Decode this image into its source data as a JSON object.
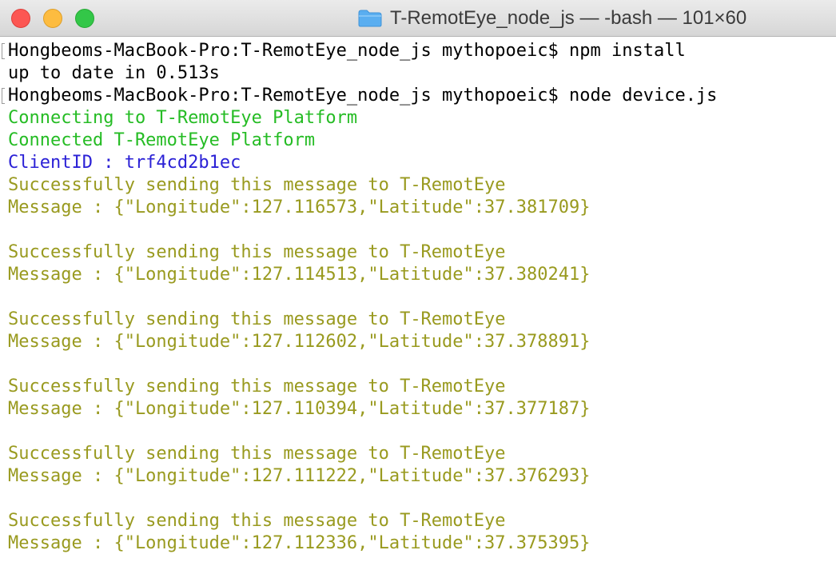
{
  "window": {
    "title": "T-RemotEye_node_js — -bash — 101×60",
    "folder_icon": "folder-icon",
    "controls": [
      "close",
      "minimize",
      "zoom"
    ]
  },
  "colors": {
    "default": "#000000",
    "green": "#25bc24",
    "blue": "#2b21d6",
    "olive": "#999a1f"
  },
  "terminal": {
    "lines": [
      {
        "text": "Hongbeoms-MacBook-Pro:T-RemotEye_node_js mythopoeic$ npm install",
        "color": "default",
        "prompt_mark": true
      },
      {
        "text": "up to date in 0.513s",
        "color": "default",
        "prompt_mark": false
      },
      {
        "text": "Hongbeoms-MacBook-Pro:T-RemotEye_node_js mythopoeic$ node device.js",
        "color": "default",
        "prompt_mark": true
      },
      {
        "text": "Connecting to T-RemotEye Platform",
        "color": "green",
        "prompt_mark": false
      },
      {
        "text": "Connected T-RemotEye Platform",
        "color": "green",
        "prompt_mark": false
      },
      {
        "text": "ClientID : trf4cd2b1ec",
        "color": "blue",
        "prompt_mark": false
      },
      {
        "text": "Successfully sending this message to T-RemotEye",
        "color": "olive",
        "prompt_mark": false
      },
      {
        "text": "Message : {\"Longitude\":127.116573,\"Latitude\":37.381709}",
        "color": "olive",
        "prompt_mark": false
      },
      {
        "text": "",
        "color": "default",
        "prompt_mark": false
      },
      {
        "text": "Successfully sending this message to T-RemotEye",
        "color": "olive",
        "prompt_mark": false
      },
      {
        "text": "Message : {\"Longitude\":127.114513,\"Latitude\":37.380241}",
        "color": "olive",
        "prompt_mark": false
      },
      {
        "text": "",
        "color": "default",
        "prompt_mark": false
      },
      {
        "text": "Successfully sending this message to T-RemotEye",
        "color": "olive",
        "prompt_mark": false
      },
      {
        "text": "Message : {\"Longitude\":127.112602,\"Latitude\":37.378891}",
        "color": "olive",
        "prompt_mark": false
      },
      {
        "text": "",
        "color": "default",
        "prompt_mark": false
      },
      {
        "text": "Successfully sending this message to T-RemotEye",
        "color": "olive",
        "prompt_mark": false
      },
      {
        "text": "Message : {\"Longitude\":127.110394,\"Latitude\":37.377187}",
        "color": "olive",
        "prompt_mark": false
      },
      {
        "text": "",
        "color": "default",
        "prompt_mark": false
      },
      {
        "text": "Successfully sending this message to T-RemotEye",
        "color": "olive",
        "prompt_mark": false
      },
      {
        "text": "Message : {\"Longitude\":127.111222,\"Latitude\":37.376293}",
        "color": "olive",
        "prompt_mark": false
      },
      {
        "text": "",
        "color": "default",
        "prompt_mark": false
      },
      {
        "text": "Successfully sending this message to T-RemotEye",
        "color": "olive",
        "prompt_mark": false
      },
      {
        "text": "Message : {\"Longitude\":127.112336,\"Latitude\":37.375395}",
        "color": "olive",
        "prompt_mark": false
      }
    ]
  }
}
